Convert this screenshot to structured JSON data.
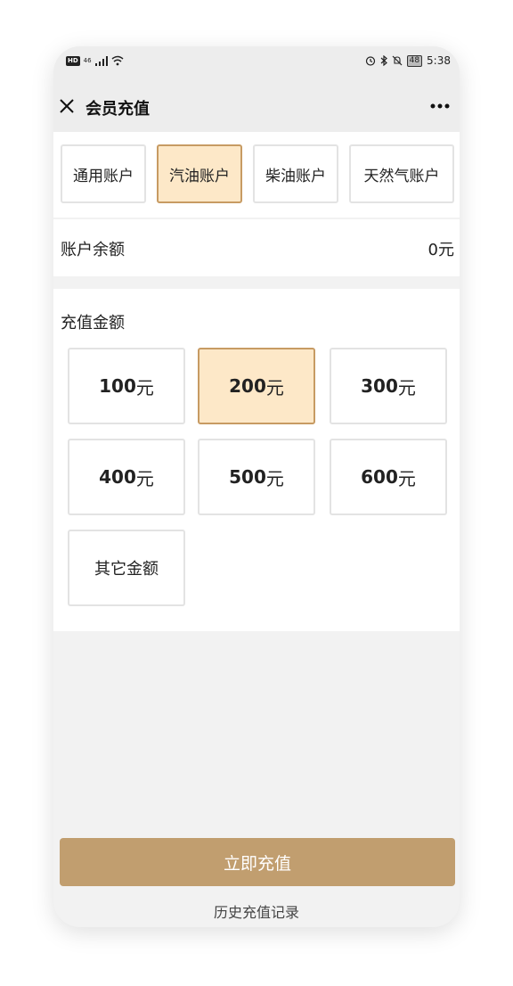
{
  "status_bar": {
    "hd": "HD",
    "network": "46",
    "battery": "48",
    "time": "5:38"
  },
  "header": {
    "title": "会员充值",
    "close_icon": "close-icon",
    "more_icon": "more-icon"
  },
  "account_tabs": {
    "items": [
      {
        "label": "通用账户",
        "active": false
      },
      {
        "label": "汽油账户",
        "active": true
      },
      {
        "label": "柴油账户",
        "active": false
      },
      {
        "label": "天然气账户",
        "active": false
      }
    ]
  },
  "balance": {
    "label": "账户余额",
    "value": "0元"
  },
  "recharge": {
    "title": "充值金额",
    "unit": "元",
    "options": [
      {
        "amount": "100",
        "active": false
      },
      {
        "amount": "200",
        "active": true
      },
      {
        "amount": "300",
        "active": false
      },
      {
        "amount": "400",
        "active": false
      },
      {
        "amount": "500",
        "active": false
      },
      {
        "amount": "600",
        "active": false
      }
    ],
    "other_label": "其它金额"
  },
  "footer": {
    "submit_label": "立即充值",
    "history_label": "历史充值记录"
  },
  "colors": {
    "accent": "#c19e6f",
    "selected_bg": "#fde8c8",
    "selected_border": "#c79b63",
    "page_bg": "#f2f2f2"
  }
}
